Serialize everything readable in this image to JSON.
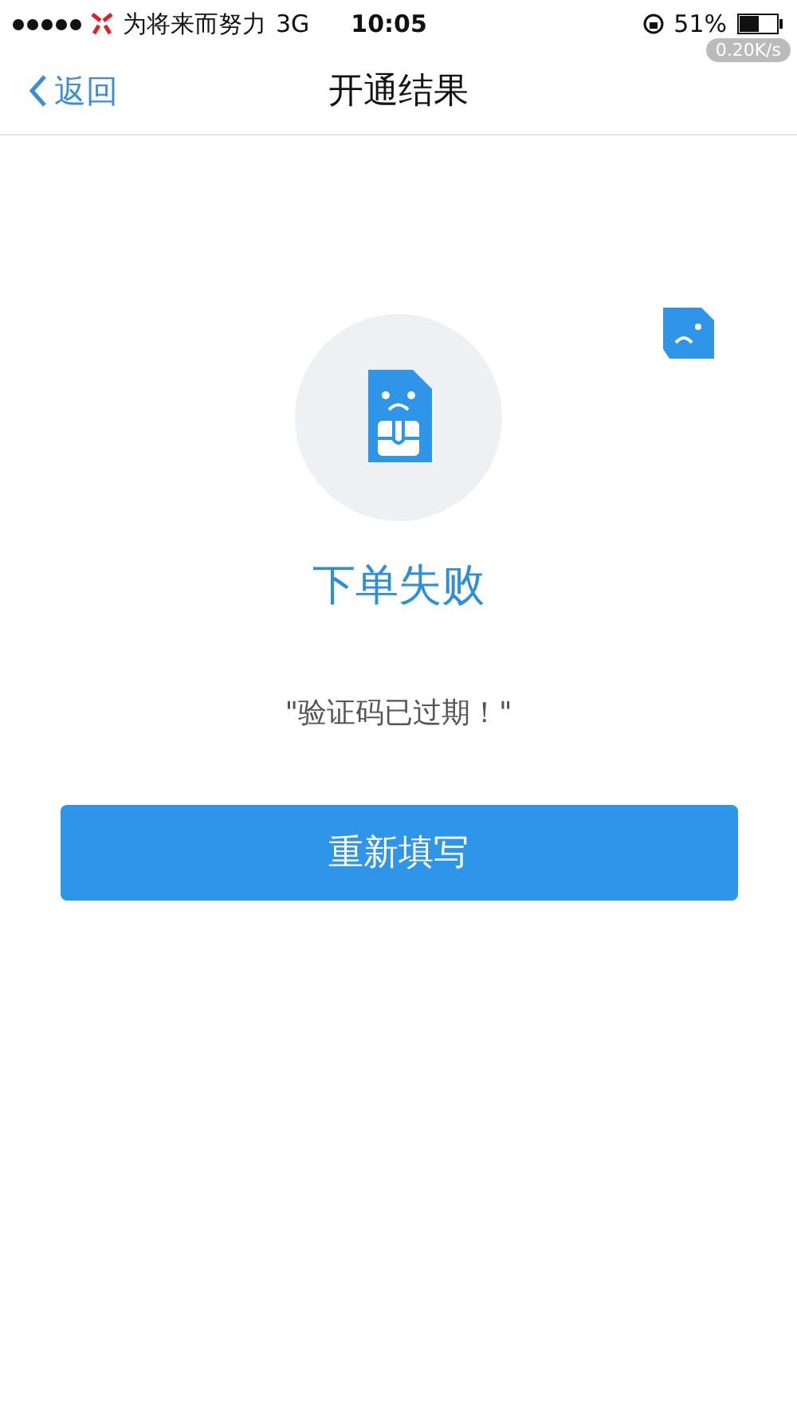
{
  "status_bar": {
    "carrier": "为将来而努力",
    "network": "3G",
    "time": "10:05",
    "battery": "51%",
    "speed": "0.20K/s"
  },
  "nav": {
    "back": "返回",
    "title": "开通结果"
  },
  "result": {
    "title": "下单失败",
    "message": "\"验证码已过期！\""
  },
  "buttons": [
    "重新填写"
  ]
}
